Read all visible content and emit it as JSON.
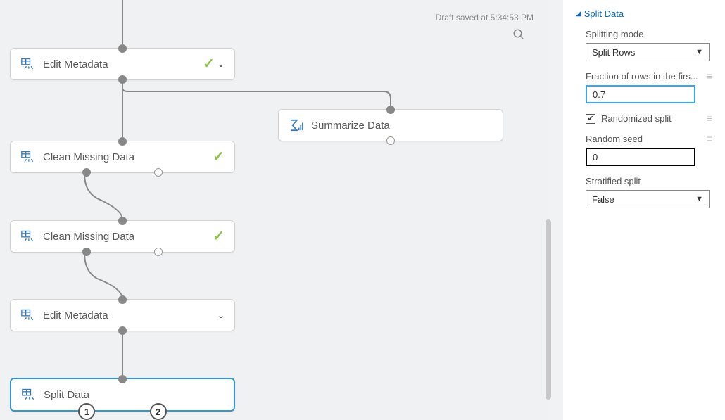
{
  "canvas": {
    "draft_saved": "Draft saved at 5:34:53 PM",
    "modules": {
      "edit_metadata_1": "Edit Metadata",
      "summarize_data": "Summarize Data",
      "clean_missing_1": "Clean Missing Data",
      "clean_missing_2": "Clean Missing Data",
      "edit_metadata_2": "Edit Metadata",
      "split_data": "Split Data"
    },
    "port_numbers": {
      "one": "1",
      "two": "2"
    }
  },
  "panel": {
    "title": "Split Data",
    "splitting_mode": {
      "label": "Splitting mode",
      "value": "Split Rows"
    },
    "fraction": {
      "label": "Fraction of rows in the firs...",
      "value": "0.7"
    },
    "randomized": {
      "label": "Randomized split",
      "checked": true,
      "mark": "✔"
    },
    "random_seed": {
      "label": "Random seed",
      "value": "0"
    },
    "stratified": {
      "label": "Stratified split",
      "value": "False"
    }
  }
}
